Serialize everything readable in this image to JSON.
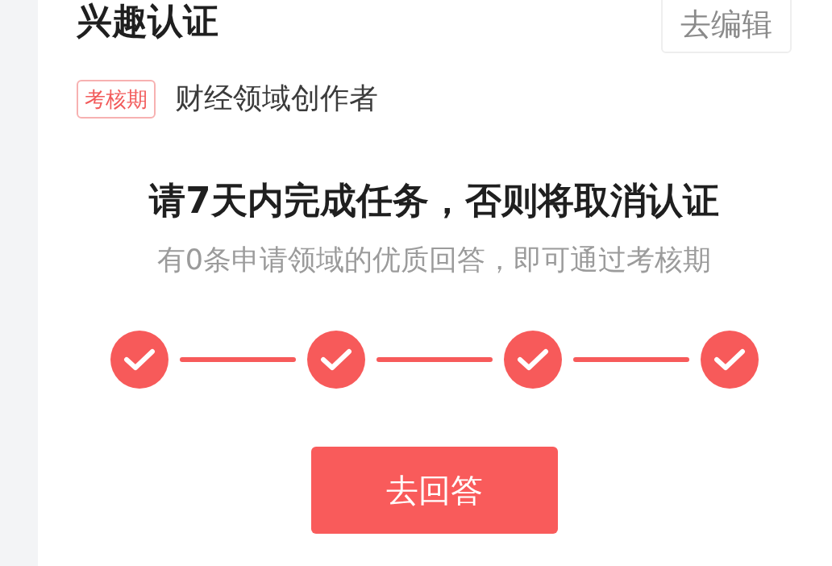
{
  "header": {
    "title": "兴趣认证",
    "edit_button": "去编辑"
  },
  "status": {
    "tag": "考核期",
    "field": "财经领域创作者"
  },
  "task": {
    "heading": "请7天内完成任务，否则将取消认证",
    "hint": "有0条申请领域的优质回答，即可通过考核期"
  },
  "steps": [
    {
      "done": true
    },
    {
      "done": true
    },
    {
      "done": true
    },
    {
      "done": true
    }
  ],
  "action_button": "去回答"
}
